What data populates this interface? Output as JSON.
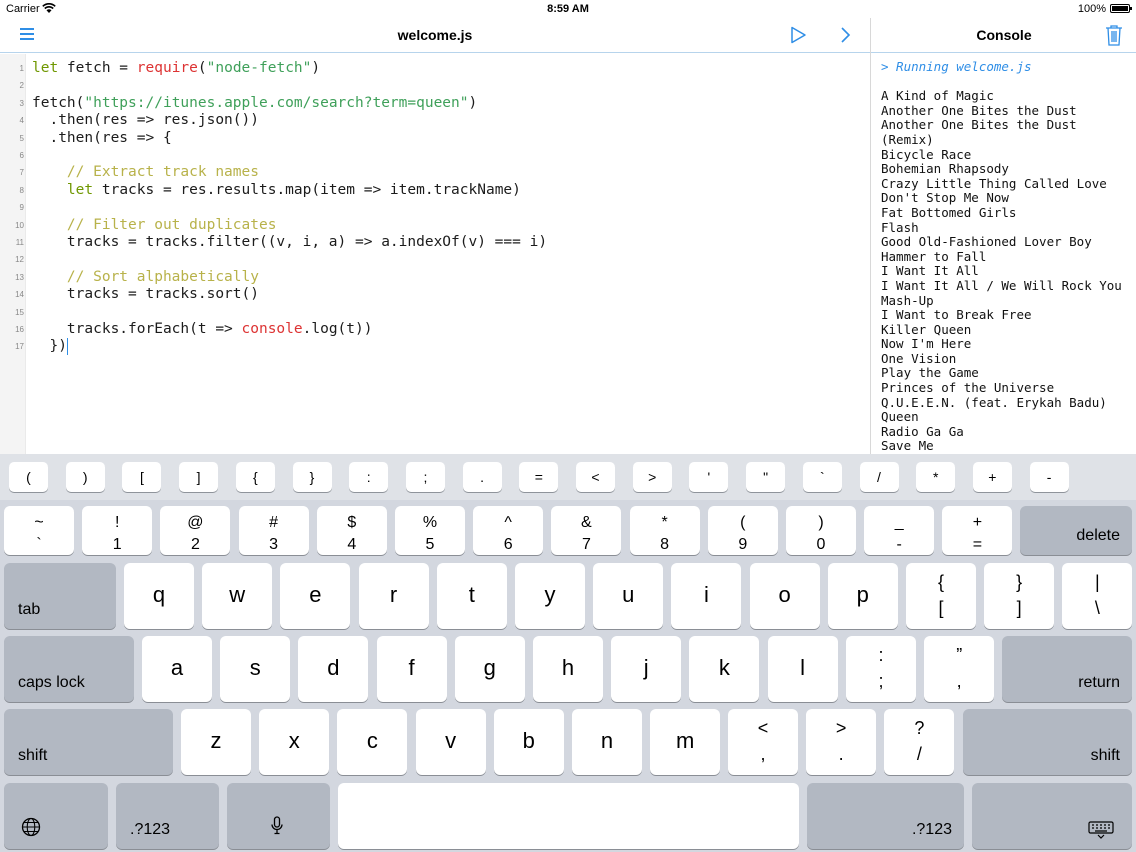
{
  "status": {
    "carrier": "Carrier",
    "time": "8:59 AM",
    "battery": "100%"
  },
  "editor": {
    "title": "welcome.js",
    "lines": [
      {
        "n": "1",
        "segs": [
          {
            "t": "let",
            "c": "kw"
          },
          {
            "t": " fetch = "
          },
          {
            "t": "require",
            "c": "fn"
          },
          {
            "t": "("
          },
          {
            "t": "\"node-fetch\"",
            "c": "str"
          },
          {
            "t": ")"
          }
        ]
      },
      {
        "n": "2",
        "segs": []
      },
      {
        "n": "3",
        "segs": [
          {
            "t": "fetch("
          },
          {
            "t": "\"https://itunes.apple.com/search?term=queen\"",
            "c": "str"
          },
          {
            "t": ")"
          }
        ]
      },
      {
        "n": "4",
        "segs": [
          {
            "t": "  .then(res => res.json())"
          }
        ]
      },
      {
        "n": "5",
        "segs": [
          {
            "t": "  .then(res => {"
          }
        ]
      },
      {
        "n": "6",
        "segs": []
      },
      {
        "n": "7",
        "segs": [
          {
            "t": "    // Extract track names",
            "c": "cm"
          }
        ]
      },
      {
        "n": "8",
        "segs": [
          {
            "t": "    "
          },
          {
            "t": "let",
            "c": "kw"
          },
          {
            "t": " tracks = res.results.map(item => item.trackName)"
          }
        ]
      },
      {
        "n": "9",
        "segs": []
      },
      {
        "n": "10",
        "segs": [
          {
            "t": "    // Filter out duplicates",
            "c": "cm"
          }
        ]
      },
      {
        "n": "11",
        "segs": [
          {
            "t": "    tracks = tracks.filter((v, i, a) => a.indexOf(v) === i)"
          }
        ]
      },
      {
        "n": "12",
        "segs": []
      },
      {
        "n": "13",
        "segs": [
          {
            "t": "    // Sort alphabetically",
            "c": "cm"
          }
        ]
      },
      {
        "n": "14",
        "segs": [
          {
            "t": "    tracks = tracks.sort()"
          }
        ]
      },
      {
        "n": "15",
        "segs": []
      },
      {
        "n": "16",
        "segs": [
          {
            "t": "    tracks.forEach(t => "
          },
          {
            "t": "console",
            "c": "fn"
          },
          {
            "t": ".log(t))"
          }
        ]
      },
      {
        "n": "17",
        "segs": [
          {
            "t": "  })"
          }
        ],
        "caret": true
      }
    ]
  },
  "console": {
    "title": "Console",
    "running": "> Running welcome.js",
    "output": [
      "A Kind of Magic",
      "Another One Bites the Dust",
      "Another One Bites the Dust",
      "(Remix)",
      "Bicycle Race",
      "Bohemian Rhapsody",
      "Crazy Little Thing Called Love",
      "Don't Stop Me Now",
      "Fat Bottomed Girls",
      "Flash",
      "Good Old-Fashioned Lover Boy",
      "Hammer to Fall",
      "I Want It All",
      "I Want It All / We Will Rock You",
      "Mash-Up",
      "I Want to Break Free",
      "Killer Queen",
      "Now I'm Here",
      "One Vision",
      "Play the Game",
      "Princes of the Universe",
      "Q.U.E.E.N. (feat. Erykah Badu)",
      "Queen",
      "Radio Ga Ga",
      "Save Me"
    ]
  },
  "keyboard": {
    "accessory": [
      "(",
      ")",
      "[",
      "]",
      "{",
      "}",
      ":",
      ";",
      ".",
      "=",
      "<",
      ">",
      "'",
      "\"",
      "`",
      "/",
      "*",
      "+",
      "-"
    ],
    "row1": [
      {
        "top": "~",
        "bot": "`"
      },
      {
        "top": "!",
        "bot": "1"
      },
      {
        "top": "@",
        "bot": "2"
      },
      {
        "top": "#",
        "bot": "3"
      },
      {
        "top": "$",
        "bot": "4"
      },
      {
        "top": "%",
        "bot": "5"
      },
      {
        "top": "^",
        "bot": "6"
      },
      {
        "top": "&",
        "bot": "7"
      },
      {
        "top": "*",
        "bot": "8"
      },
      {
        "top": "(",
        "bot": "9"
      },
      {
        "top": ")",
        "bot": "0"
      },
      {
        "top": "_",
        "bot": "-"
      },
      {
        "top": "+",
        "bot": "="
      }
    ],
    "delete": "delete",
    "tab": "tab",
    "row2": [
      "q",
      "w",
      "e",
      "r",
      "t",
      "y",
      "u",
      "i",
      "o",
      "p"
    ],
    "row2_sym": [
      {
        "top": "{",
        "bot": "["
      },
      {
        "top": "}",
        "bot": "]"
      },
      {
        "top": "|",
        "bot": "\\"
      }
    ],
    "caps": "caps lock",
    "row3": [
      "a",
      "s",
      "d",
      "f",
      "g",
      "h",
      "j",
      "k",
      "l"
    ],
    "row3_sym": [
      {
        "top": ":",
        "bot": ";"
      },
      {
        "top": "”",
        "bot": ","
      }
    ],
    "return": "return",
    "shift": "shift",
    "row4": [
      "z",
      "x",
      "c",
      "v",
      "b",
      "n",
      "m"
    ],
    "row4_sym": [
      {
        "top": "<",
        "bot": ","
      },
      {
        "top": ">",
        "bot": "."
      },
      {
        "top": "?",
        "bot": "/"
      }
    ],
    "numbers": ".?123"
  }
}
